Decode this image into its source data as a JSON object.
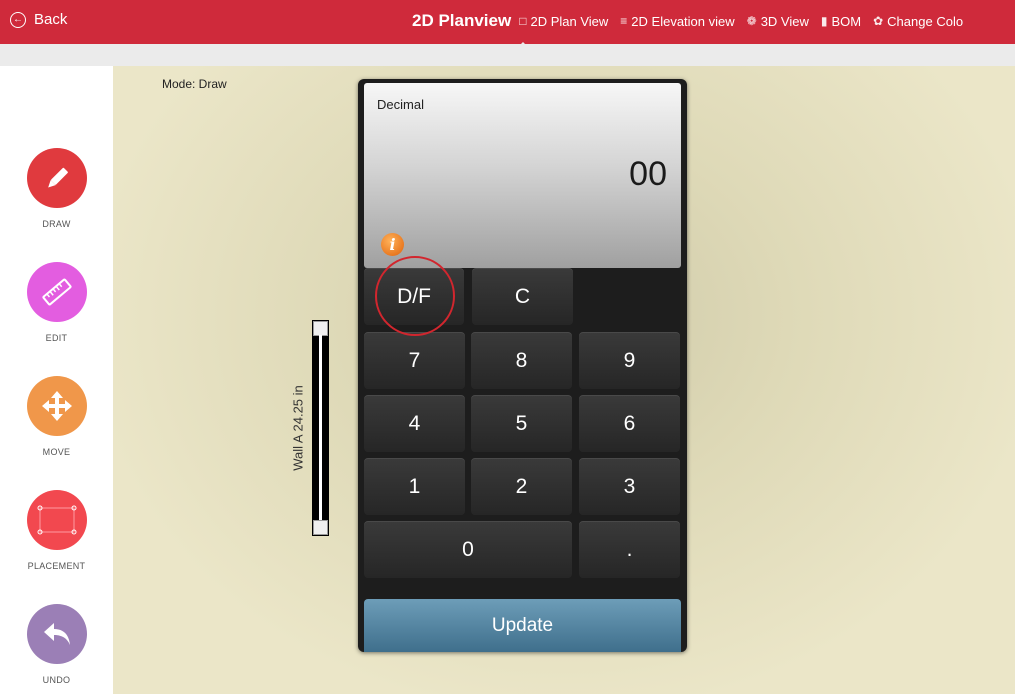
{
  "topbar": {
    "back_label": "Back",
    "title": "2D Planview",
    "nav": [
      {
        "label": "2D Plan View",
        "icon": "plan-icon"
      },
      {
        "label": "2D Elevation view",
        "icon": "list-icon"
      },
      {
        "label": "3D View",
        "icon": "cube-icon"
      },
      {
        "label": "BOM",
        "icon": "document-icon"
      },
      {
        "label": "Change Colo",
        "icon": "palette-icon"
      }
    ]
  },
  "sidebar": {
    "tools": [
      {
        "label": "DRAW",
        "icon": "pencil-icon",
        "color": "#e03a3e"
      },
      {
        "label": "EDIT",
        "icon": "ruler-icon",
        "color": "#e35de0"
      },
      {
        "label": "MOVE",
        "icon": "move-arrows-icon",
        "color": "#f0974a"
      },
      {
        "label": "PLACEMENT",
        "icon": "placement-icon",
        "color": "#f2484f"
      },
      {
        "label": "UNDO",
        "icon": "undo-icon",
        "color": "#9b7fb6"
      }
    ]
  },
  "canvas": {
    "mode": "Mode: Draw",
    "wall_label": "Wall A 24.25 in"
  },
  "calculator": {
    "display_label": "Decimal",
    "display_value": "00",
    "keys": {
      "df": "D/F",
      "clear": "C",
      "k7": "7",
      "k8": "8",
      "k9": "9",
      "k4": "4",
      "k5": "5",
      "k6": "6",
      "k1": "1",
      "k2": "2",
      "k3": "3",
      "k0": "0",
      "dot": "."
    },
    "update_label": "Update"
  },
  "colors": {
    "topbar": "#cf2a3b",
    "highlight_circle": "#d2262e",
    "update_button": "#4f7f9c"
  }
}
